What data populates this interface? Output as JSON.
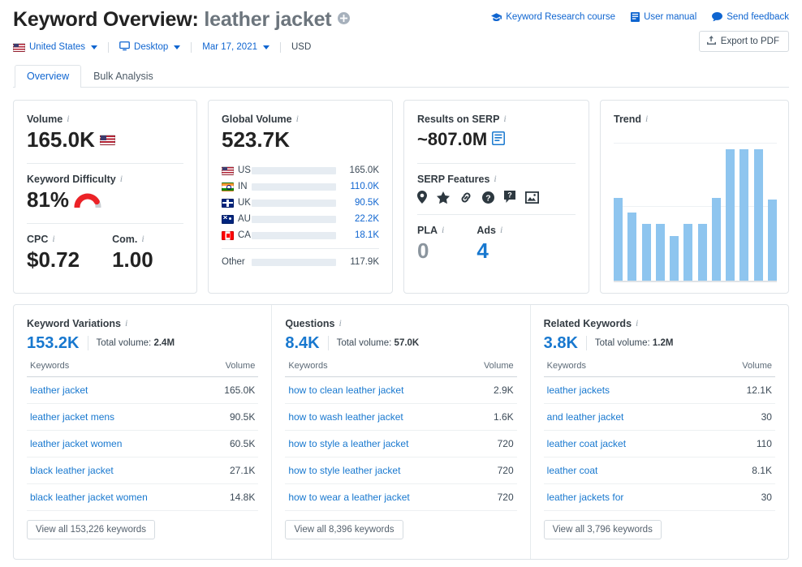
{
  "header": {
    "title_prefix": "Keyword Overview:",
    "keyword": "leather jacket",
    "add_icon": "plus-circle-icon",
    "links": [
      {
        "label": "Keyword Research course",
        "icon": "graduation-cap-icon"
      },
      {
        "label": "User manual",
        "icon": "book-icon"
      },
      {
        "label": "Send feedback",
        "icon": "speech-bubble-icon"
      }
    ],
    "export_label": "Export to PDF",
    "export_icon": "upload-icon",
    "meta": {
      "country": "United States",
      "country_flag": "flag-us",
      "device": "Desktop",
      "device_icon": "monitor-icon",
      "date": "Mar 17, 2021",
      "currency": "USD"
    },
    "tabs": [
      {
        "label": "Overview",
        "active": true
      },
      {
        "label": "Bulk Analysis",
        "active": false
      }
    ]
  },
  "cards": {
    "volume": {
      "label": "Volume",
      "value": "165.0K",
      "flag": "flag-us",
      "difficulty_label": "Keyword Difficulty",
      "difficulty_value": "81%",
      "difficulty_pct": 81,
      "cpc_label": "CPC",
      "cpc_value": "$0.72",
      "com_label": "Com.",
      "com_value": "1.00"
    },
    "global_volume": {
      "label": "Global Volume",
      "value": "523.7K",
      "rows": [
        {
          "cc": "US",
          "flag": "flag-us",
          "value": "165.0K",
          "pct": 100,
          "highlight": true
        },
        {
          "cc": "IN",
          "flag": "flag-in",
          "value": "110.0K",
          "pct": 23,
          "highlight": false
        },
        {
          "cc": "UK",
          "flag": "flag-uk",
          "value": "90.5K",
          "pct": 19,
          "highlight": false
        },
        {
          "cc": "AU",
          "flag": "flag-au",
          "value": "22.2K",
          "pct": 4,
          "highlight": false
        },
        {
          "cc": "CA",
          "flag": "flag-ca",
          "value": "18.1K",
          "pct": 4,
          "highlight": false
        }
      ],
      "other_label": "Other",
      "other_value": "117.9K",
      "other_pct": 25
    },
    "serp": {
      "label": "Results on SERP",
      "value": "~807.0M",
      "value_icon": "serp-list-icon",
      "features_label": "SERP Features",
      "features": [
        "map-pin-icon",
        "star-icon",
        "link-icon",
        "question-circle-icon",
        "question-bubble-icon",
        "image-icon"
      ],
      "pla_label": "PLA",
      "pla_value": "0",
      "ads_label": "Ads",
      "ads_value": "4"
    },
    "trend": {
      "label": "Trend"
    }
  },
  "chart_data": {
    "type": "bar",
    "title": "Trend",
    "categories": [
      "1",
      "2",
      "3",
      "4",
      "5",
      "6",
      "7",
      "8",
      "9",
      "10",
      "11",
      "12"
    ],
    "values": [
      63,
      52,
      43,
      43,
      34,
      43,
      43,
      63,
      100,
      100,
      100,
      62
    ],
    "xlabel": "",
    "ylabel": "",
    "ylim": [
      0,
      100
    ],
    "grid": true,
    "legend": false,
    "bar_color": "#8ec5ef"
  },
  "panels": [
    {
      "title": "Keyword Variations",
      "count": "153.2K",
      "total_label": "Total volume:",
      "total_value": "2.4M",
      "columns": [
        "Keywords",
        "Volume"
      ],
      "rows": [
        {
          "keyword": "leather jacket",
          "volume": "165.0K"
        },
        {
          "keyword": "leather jacket mens",
          "volume": "90.5K"
        },
        {
          "keyword": "leather jacket women",
          "volume": "60.5K"
        },
        {
          "keyword": "black leather jacket",
          "volume": "27.1K"
        },
        {
          "keyword": "black leather jacket women",
          "volume": "14.8K"
        }
      ],
      "view_all": "View all 153,226 keywords"
    },
    {
      "title": "Questions",
      "count": "8.4K",
      "total_label": "Total volume:",
      "total_value": "57.0K",
      "columns": [
        "Keywords",
        "Volume"
      ],
      "rows": [
        {
          "keyword": "how to clean leather jacket",
          "volume": "2.9K"
        },
        {
          "keyword": "how to wash leather jacket",
          "volume": "1.6K"
        },
        {
          "keyword": "how to style a leather jacket",
          "volume": "720"
        },
        {
          "keyword": "how to style leather jacket",
          "volume": "720"
        },
        {
          "keyword": "how to wear a leather jacket",
          "volume": "720"
        }
      ],
      "view_all": "View all 8,396 keywords"
    },
    {
      "title": "Related Keywords",
      "count": "3.8K",
      "total_label": "Total volume:",
      "total_value": "1.2M",
      "columns": [
        "Keywords",
        "Volume"
      ],
      "rows": [
        {
          "keyword": "leather jackets",
          "volume": "12.1K"
        },
        {
          "keyword": "and leather jacket",
          "volume": "30"
        },
        {
          "keyword": "leather coat jacket",
          "volume": "110"
        },
        {
          "keyword": "leather coat",
          "volume": "8.1K"
        },
        {
          "keyword": "leather jackets for",
          "volume": "30"
        }
      ],
      "view_all": "View all 3,796 keywords"
    }
  ],
  "colors": {
    "link": "#0f65d0",
    "accent": "#1878cf",
    "bar": "#8ec5ef",
    "bar_dark": "#1a73c7",
    "danger": "#ec2227"
  }
}
